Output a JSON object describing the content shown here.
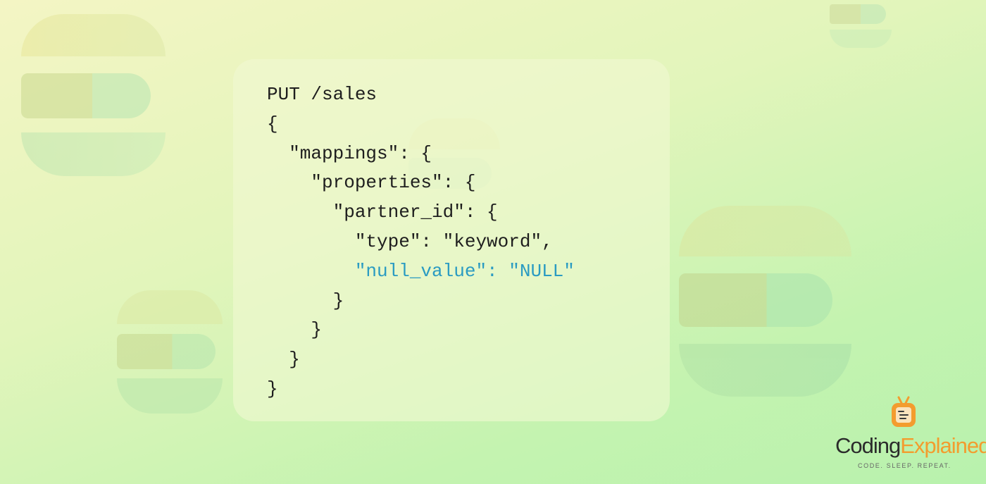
{
  "code_block": {
    "lines": [
      {
        "text": "PUT /sales",
        "highlight": false
      },
      {
        "text": "{",
        "highlight": false
      },
      {
        "text": "  \"mappings\": {",
        "highlight": false
      },
      {
        "text": "    \"properties\": {",
        "highlight": false
      },
      {
        "text": "      \"partner_id\": {",
        "highlight": false
      },
      {
        "text": "        \"type\": \"keyword\",",
        "highlight": false
      },
      {
        "text": "        \"null_value\": \"NULL\"",
        "highlight": true
      },
      {
        "text": "      }",
        "highlight": false
      },
      {
        "text": "    }",
        "highlight": false
      },
      {
        "text": "  }",
        "highlight": false
      },
      {
        "text": "}",
        "highlight": false
      }
    ],
    "text_color": "#1e1e1e",
    "highlight_color": "#2a9bc2"
  },
  "brand": {
    "name_part1": "Coding",
    "name_part2": "Explained",
    "tagline": "CODE. SLEEP. REPEAT.",
    "icon": "tv-icon",
    "accent_color": "#f39c2e"
  }
}
